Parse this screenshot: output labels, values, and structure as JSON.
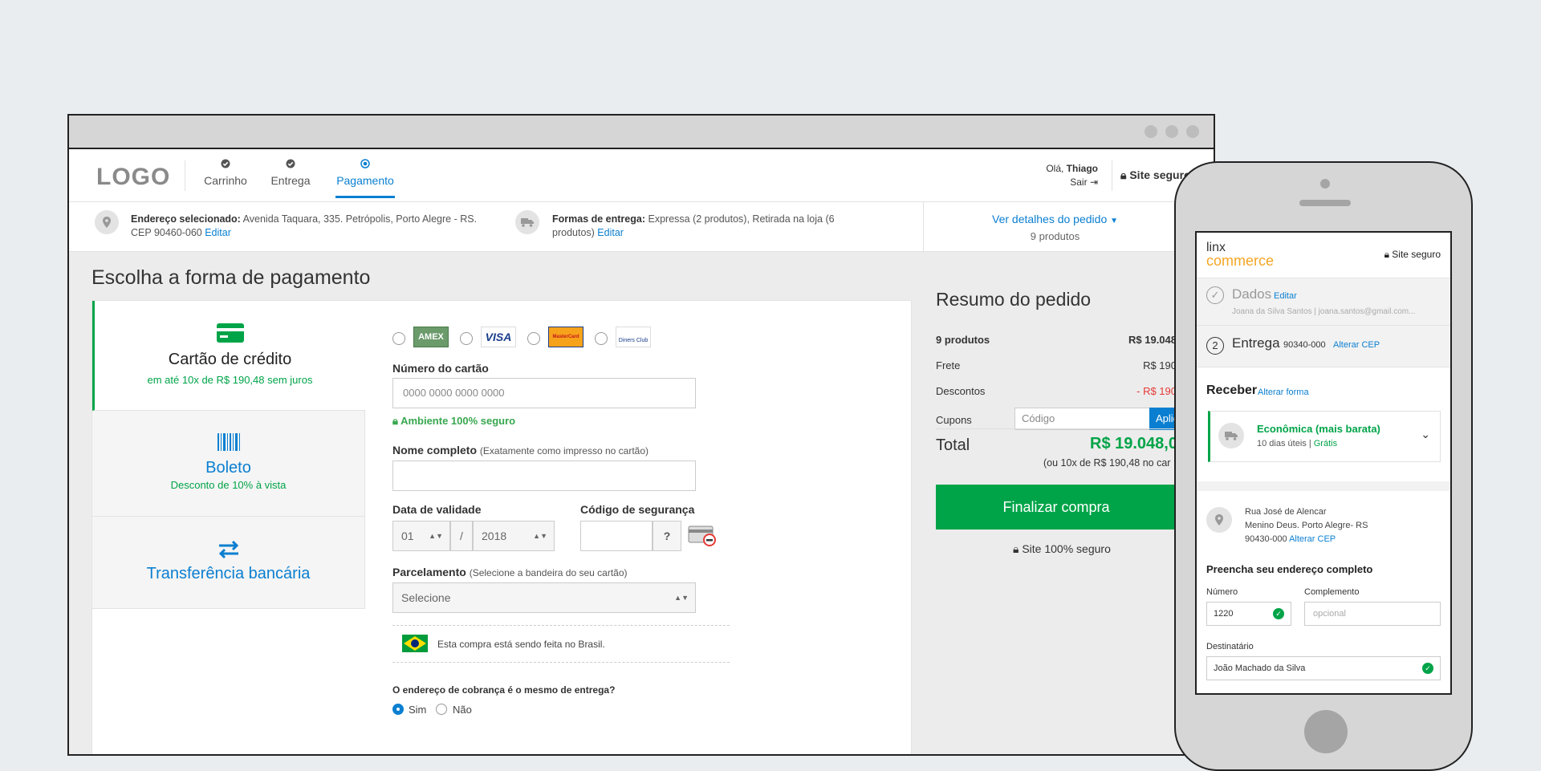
{
  "desktop": {
    "logo": "LOGO",
    "steps": [
      {
        "label": "Carrinho",
        "icon": "check-circle-icon"
      },
      {
        "label": "Entrega",
        "icon": "check-circle-icon"
      },
      {
        "label": "Pagamento",
        "icon": "dot-circle-icon"
      }
    ],
    "user": {
      "greeting": "Olá,",
      "name": "Thiago",
      "logout": "Sair"
    },
    "secure_badge": "Site seguro",
    "info": {
      "address_label": "Endereço selecionado:",
      "address_value": "Avenida Taquara, 335. Petrópolis, Porto Alegre - RS. CEP 90460-060",
      "address_edit": "Editar",
      "delivery_label": "Formas de entrega:",
      "delivery_value": "Expressa (2 produtos), Retirada na loja (6 produtos)",
      "delivery_edit": "Editar",
      "details_link": "Ver detalhes do pedido",
      "details_count": "9 produtos"
    },
    "payment": {
      "title": "Escolha a forma de pagamento",
      "tabs": [
        {
          "name": "Cartão de crédito",
          "sub": "em até 10x de R$ 190,48 sem juros"
        },
        {
          "name": "Boleto",
          "sub": "Desconto de 10% à vista"
        },
        {
          "name": "Transferência bancária"
        }
      ],
      "card_brands": [
        "AMEX",
        "VISA",
        "MasterCard",
        "Diners Club"
      ],
      "card_number_label": "Número do cartão",
      "card_number_placeholder": "0000 0000 0000 0000",
      "secure_env": "Ambiente 100% seguro",
      "name_label": "Nome completo",
      "name_hint": "(Exatamente como impresso no cartão)",
      "validity_label": "Data de validade",
      "month": "01",
      "slash": "/",
      "year": "2018",
      "cvv_label": "Código de segurança",
      "cvv_help": "?",
      "installments_label": "Parcelamento",
      "installments_hint": "(Selecione a bandeira do seu cartão)",
      "installments_value": "Selecione",
      "brazil_note": "Esta compra está sendo feita no Brasil.",
      "billing_question": "O endereço de cobrança é o mesmo de entrega?",
      "yes": "Sim",
      "no": "Não"
    },
    "summary": {
      "title": "Resumo do pedido",
      "products_label": "9 produtos",
      "products_value": "R$ 19.048",
      "shipping_label": "Frete",
      "shipping_value": "R$ 190",
      "discounts_label": "Descontos",
      "discounts_value": "- R$ 190",
      "coupons_label": "Cupons",
      "coupon_placeholder": "Código",
      "apply_button": "Aplic",
      "total_label": "Total",
      "total_value": "R$ 19.048,0",
      "total_installments": "(ou 10x de R$ 190,48 no car",
      "finalize_button": "Finalizar compra",
      "safe_text": "Site 100% seguro"
    }
  },
  "mobile": {
    "brand_top": "linx",
    "brand_bottom": "commerce",
    "secure": "Site seguro",
    "dados_label": "Dados",
    "dados_edit": "Editar",
    "dados_sub": "Joana da Silva Santos | joana.santos@gmail.com...",
    "entrega_num": "2",
    "entrega_label": "Entrega",
    "entrega_cep": "90340-000",
    "alterar_cep": "Alterar CEP",
    "receber_label": "Receber",
    "alterar_forma": "Alterar forma",
    "shipping_option": "Econômica (mais barata)",
    "shipping_days": "10 dias úteis |",
    "shipping_price": "Grátis",
    "address_line1": "Rua José de Alencar",
    "address_line2": "Menino Deus. Porto Alegre- RS",
    "address_cep": "90430-000",
    "address_change": "Alterar CEP",
    "complete_title": "Preencha seu endereço completo",
    "numero_label": "Número",
    "numero_value": "1220",
    "complemento_label": "Complemento",
    "complemento_placeholder": "opcional",
    "destinatario_label": "Destinatário",
    "destinatario_value": "João Machado da Silva"
  },
  "colors": {
    "primary": "#0a7fd1",
    "success": "#00a448",
    "danger": "#e53935",
    "accent": "#f5a623"
  }
}
